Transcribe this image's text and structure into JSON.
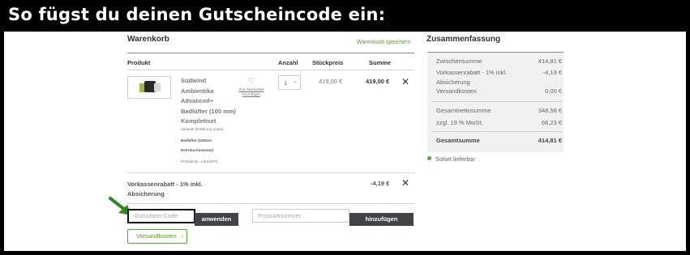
{
  "banner": "So fügst du deinen Gutscheincode ein:",
  "cart": {
    "title": "Warenkorb",
    "save_link": "Warenkorb speichern",
    "headers": {
      "product": "Produkt",
      "quantity": "Anzahl",
      "unit_price": "Stückpreis",
      "sum": "Summe"
    },
    "item": {
      "name_lines": [
        "Südwind",
        "Ambientika",
        "Advanced+",
        "Badlüfter (100 mm)",
        "Komplettset"
      ],
      "wishlist_label_lines": [
        "Zum Merkzettel",
        "hinzufügen"
      ],
      "variant_label": "Variante (Erklärung unten):",
      "variant_value_lines": [
        "Badlüfter (100mm",
        "Rohrdurchmesser)"
      ],
      "product_no": "Produkt-Nr.: LB103071",
      "quantity": "1",
      "unit_price": "419,00 €",
      "sum": "419,00 €"
    },
    "discount": {
      "label_lines": [
        "Vorkassenrabatt - 1% inkl.",
        "Absicherung"
      ],
      "value": "-4,19 €"
    },
    "voucher": {
      "placeholder": "Gutschein-Code",
      "apply": "anwenden"
    },
    "product_number": {
      "placeholder": "Produktnummer",
      "add": "hinzufügen"
    },
    "shipping_button": "Versandkosten"
  },
  "summary": {
    "title": "Zusammenfassung",
    "rows": [
      {
        "label": "Zwischensumme",
        "value": "414,81 €"
      },
      {
        "label": "Vorkassenrabatt - 1% inkl.",
        "value": "-4,19 €"
      },
      {
        "label": "Absicherung",
        "value": ""
      },
      {
        "label": "Versandkosten",
        "value": "0,00 €"
      },
      {
        "label": "Gesamtnettosumme",
        "value": "348,58 €"
      },
      {
        "label": "zzgl. 19 % MwSt.",
        "value": "66,23 €"
      },
      {
        "label": "Gesamtsumme",
        "value": "414,81 €"
      }
    ],
    "delivery": "Sofort lieferbar"
  },
  "colors": {
    "accent_green": "#5aa32d",
    "arrow_green": "#2e8b1a",
    "button_dark": "#3f4448"
  }
}
